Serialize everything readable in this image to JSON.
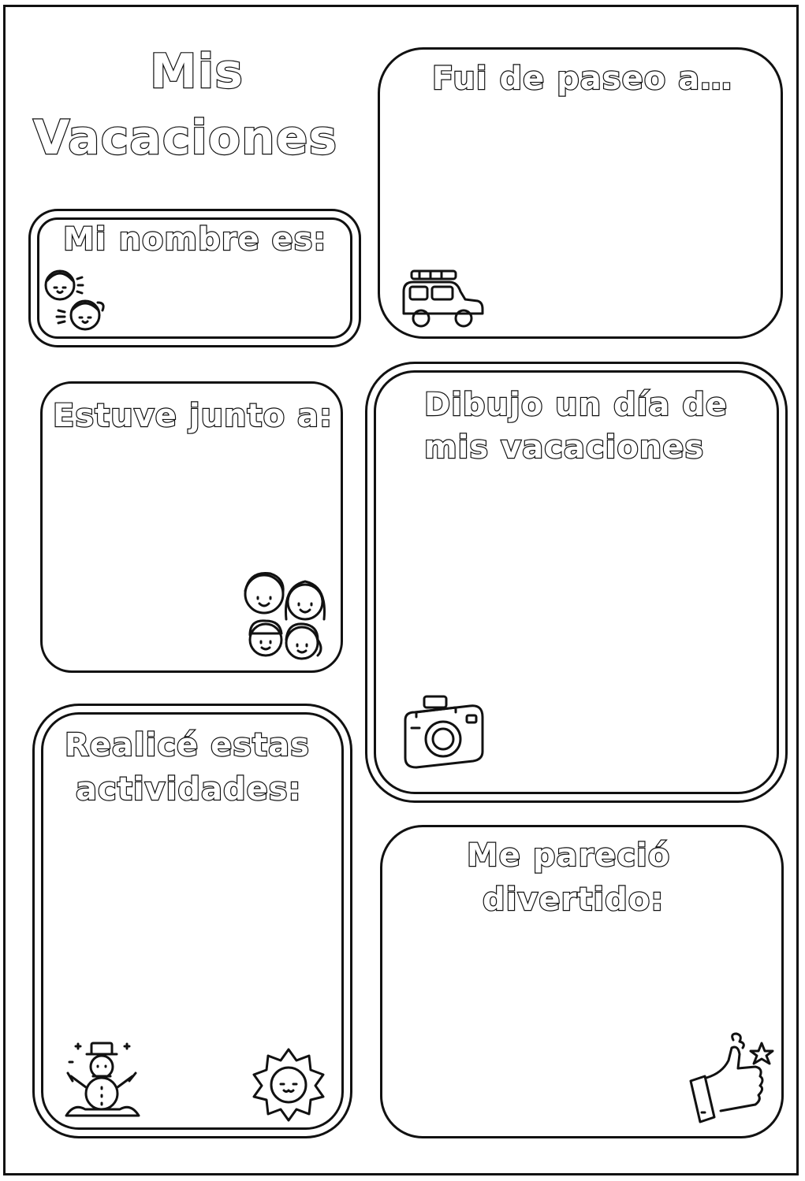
{
  "title": {
    "line1": "Mis",
    "line2": "Vacaciones"
  },
  "sections": {
    "name": {
      "heading": "Mi nombre es:"
    },
    "trip": {
      "heading": "Fui de paseo a…"
    },
    "company": {
      "heading": "Estuve junto a:"
    },
    "drawing": {
      "line1": "Dibujo un día de",
      "line2": "mis vacaciones"
    },
    "activities": {
      "line1": "Realicé estas",
      "line2": "actividades:"
    },
    "fun": {
      "line1": "Me pareció",
      "line2": "divertido:"
    }
  },
  "icons": {
    "name": "kids-faces-icon",
    "trip": "car-icon",
    "company": "family-icon",
    "drawing": "camera-icon",
    "activities_left": "snowman-icon",
    "activities_right": "sun-icon",
    "fun": "thumbs-up-icon"
  },
  "colors": {
    "ink": "#111111",
    "paper": "#ffffff"
  }
}
